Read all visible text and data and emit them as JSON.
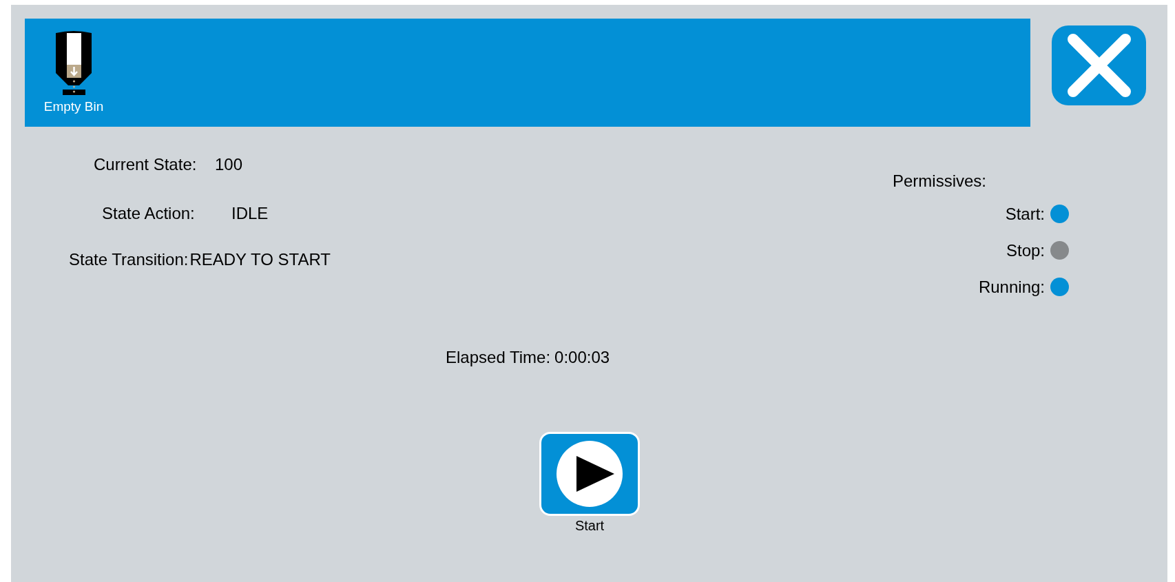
{
  "header": {
    "tool_label": "Empty Bin"
  },
  "status": [
    {
      "label": "Current State:",
      "value": "100"
    },
    {
      "label": "State Action:",
      "value": "IDLE"
    },
    {
      "label": "State Transition:",
      "value": "READY TO START"
    }
  ],
  "permissives": {
    "title": "Permissives:",
    "items": [
      {
        "label": "Start:",
        "on": true
      },
      {
        "label": "Stop:",
        "on": false
      },
      {
        "label": "Running:",
        "on": true
      }
    ]
  },
  "elapsed": {
    "label": "Elapsed Time:",
    "value": "0:00:03"
  },
  "start_button": {
    "label": "Start"
  }
}
